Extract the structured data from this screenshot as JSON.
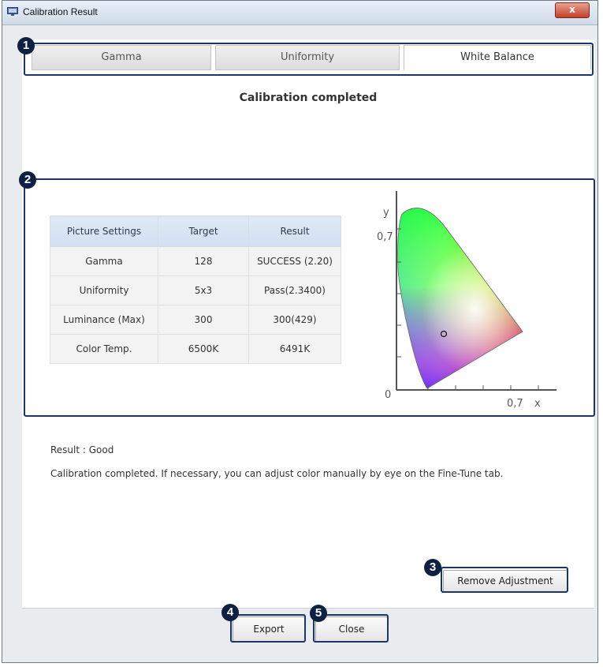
{
  "window": {
    "title": "Calibration Result",
    "close_label": "x",
    "app_icon": "monitor-icon"
  },
  "tabs": [
    {
      "label": "Gamma"
    },
    {
      "label": "Uniformity"
    },
    {
      "label": "White Balance"
    }
  ],
  "heading": "Calibration completed",
  "markers": [
    "1",
    "2",
    "3",
    "4",
    "5"
  ],
  "table": {
    "headers": [
      "Picture Settings",
      "Target",
      "Result"
    ],
    "rows": [
      [
        "Gamma",
        "128",
        "SUCCESS (2.20)"
      ],
      [
        "Uniformity",
        "5x3",
        "Pass(2.3400)"
      ],
      [
        "Luminance (Max)",
        "300",
        "300(429)"
      ],
      [
        "Color Temp.",
        "6500K",
        "6491K"
      ]
    ]
  },
  "cie_chart": {
    "y_axis_label": "y",
    "x_axis_label": "x",
    "y_tick": "0,7",
    "x_tick": "0,7",
    "origin": "0"
  },
  "result": {
    "summary": "Result : Good",
    "message": "Calibration completed. If necessary, you can adjust color manually by eye on the Fine-Tune tab."
  },
  "buttons": {
    "remove_adjustment": "Remove Adjustment",
    "export": "Export",
    "close": "Close"
  },
  "colors": {
    "highlight": "#1a3766",
    "marker_bg": "#0e2142"
  }
}
